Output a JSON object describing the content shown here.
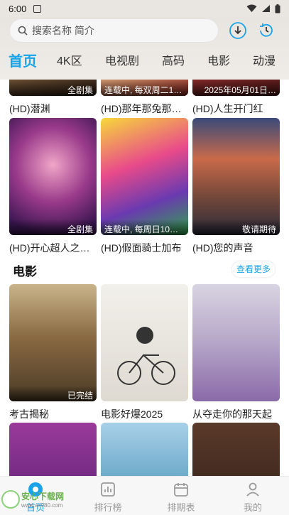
{
  "status": {
    "time": "6:00"
  },
  "search": {
    "placeholder": "搜索名称 简介"
  },
  "header": {
    "icons": [
      "download-icon",
      "history-icon"
    ],
    "tabs": [
      {
        "label": "首页",
        "active": true
      },
      {
        "label": "4K区"
      },
      {
        "label": "电视剧"
      },
      {
        "label": "高码"
      },
      {
        "label": "电影"
      },
      {
        "label": "动漫"
      }
    ]
  },
  "rows": [
    [
      {
        "title": "(HD)潜渊",
        "badge": "全剧集"
      },
      {
        "title": "(HD)那年那兔那…",
        "badge": "连载中, 每双周二1…"
      },
      {
        "title": "(HD)人生开门红",
        "badge": "2025年05月01日…"
      }
    ],
    [
      {
        "title": "(HD)开心超人之…",
        "badge": "全剧集"
      },
      {
        "title": "(HD)假面骑士加布",
        "badge": "连载中, 每周日10…"
      },
      {
        "title": "(HD)您的声音",
        "badge": "敬请期待"
      }
    ]
  ],
  "movies": {
    "section_title": "电影",
    "more_label": "查看更多",
    "items": [
      {
        "title": "考古揭秘",
        "badge": "已完结"
      },
      {
        "title": "电影好爆2025",
        "badge": ""
      },
      {
        "title": "从夺走你的那天起",
        "badge": ""
      }
    ]
  },
  "tabbar": {
    "items": [
      {
        "label": "首页",
        "icon": "home-icon",
        "active": true
      },
      {
        "label": "排行榜",
        "icon": "ranking-icon"
      },
      {
        "label": "排期表",
        "icon": "schedule-icon"
      },
      {
        "label": "我的",
        "icon": "profile-icon"
      }
    ]
  },
  "watermark": {
    "site": "安心下载网",
    "domain": "www.ax980.com"
  },
  "colors": {
    "accent": "#1aa3e8"
  }
}
